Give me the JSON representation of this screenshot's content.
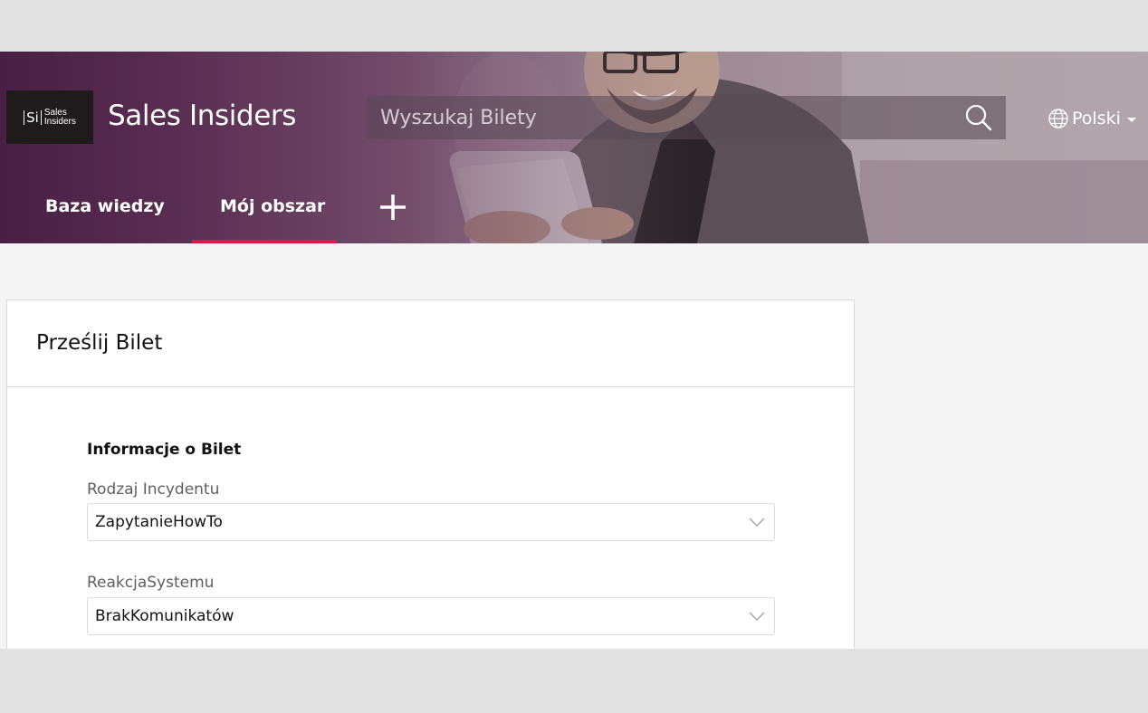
{
  "brand": {
    "logo_mark": "Si",
    "logo_line1": "Sales",
    "logo_line2": "Insiders",
    "title": "Sales Insiders"
  },
  "search": {
    "placeholder": "Wyszukaj Bilety",
    "button_icon": "search-icon"
  },
  "language": {
    "label": "Polski",
    "icon": "globe-icon"
  },
  "nav": {
    "items": [
      {
        "label": "Baza wiedzy",
        "active": false
      },
      {
        "label": "Mój obszar",
        "active": true
      }
    ],
    "add_icon": "plus-icon",
    "active_color": "#e8124b"
  },
  "form": {
    "title": "Prześlij Bilet",
    "section_title": "Informacje o Bilet",
    "fields": [
      {
        "label": "Rodzaj Incydentu",
        "value": "ZapytanieHowTo"
      },
      {
        "label": "ReakcjaSystemu",
        "value": "BrakKomunikatów"
      }
    ]
  }
}
